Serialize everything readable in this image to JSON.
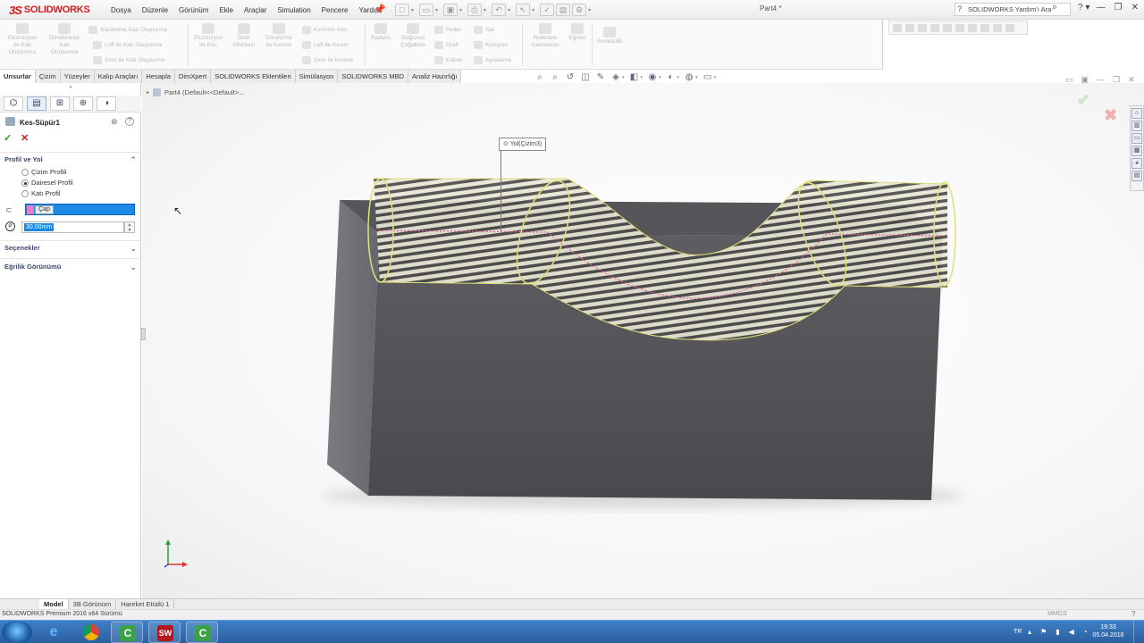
{
  "app": {
    "logo_text": "SOLIDWORKS",
    "logo_mark": "3S",
    "document_title": "Part4 *"
  },
  "menu": [
    "Dosya",
    "Düzenle",
    "Görünüm",
    "Ekle",
    "Araçlar",
    "Simulation",
    "Pencere",
    "Yardım"
  ],
  "help_search": {
    "placeholder": "SOLIDWORKS Yardım'ı Ara"
  },
  "window_controls": {
    "minimize": "—",
    "restore": "❐",
    "close": "✕"
  },
  "command_manager": {
    "extrude_boss": "Ekstrüzyon\nile Katı\nOluşturma",
    "revolve_boss": "Döndürerek\nKatı\nOluşturma",
    "sweep_boss": "Süpürerek Katı Oluşturma",
    "loft_boss": "Loft ile Katı Oluşturma",
    "boundary_boss": "Sınır ile Katı Oluşturma",
    "extrude_cut": "Ekstrüzyon\nile Kes",
    "hole_wizard": "Delik\nSihirbazı",
    "revolve_cut": "Döndürme\nile Kesme",
    "swept_cut": "Kırınımlı Kes",
    "lofted_cut": "Loft ile Kesim",
    "boundary_cut": "Sınır ile Kesme",
    "fillet": "Radyüs",
    "linear_pattern": "Doğrusal\nÇoğaltma",
    "rib": "Feder",
    "draft": "Draft",
    "shell": "Kabuk",
    "wrap": "Sar",
    "intersect": "Kesişme",
    "mirror": "Aynalama",
    "reference_geometry": "Referans\nGeometrisi",
    "curves": "Eğriler",
    "instant3d": "Anında3B"
  },
  "tabs": [
    "Unsurlar",
    "Çizim",
    "Yüzeyler",
    "Kalıp Araçları",
    "Hesapla",
    "DimXpert",
    "SOLIDWORKS Eklentileri",
    "Simülasyon",
    "SOLIDWORKS MBD",
    "Analiz Hazırlığı"
  ],
  "active_tab": "Unsurlar",
  "feature_manager": {
    "breadcrumb": "Part4  (Default<<Default>..."
  },
  "property_manager": {
    "title": "Kes-Süpür1",
    "groups": {
      "profile_path": "Profil ve Yol",
      "options": "Seçenekler",
      "curvature": "Eğrilik Görünümü"
    },
    "profile_options": [
      "Çizim Profili",
      "Dairesel Profil",
      "Katı Profil"
    ],
    "selected_profile": "Dairesel Profil",
    "path_selection_tag": "Çap",
    "diameter_value": "30.00mm"
  },
  "graphics": {
    "path_callout": "Yol(Çizim3)"
  },
  "bottom_tabs": [
    "Model",
    "3B Görünüm",
    "Hareket Etüdü 1"
  ],
  "active_bottom_tab": "Model",
  "status": {
    "text": "SOLIDWORKS Premium 2016 x64 Sürümü",
    "units": "MMGS",
    "help": "?"
  },
  "taskbar": {
    "apps": [
      "windows-explorer",
      "internet-explorer",
      "chrome",
      "camtasia",
      "solidworks",
      "camtasia-recorder"
    ],
    "language": "TR",
    "time": "19:33",
    "date": "05.04.2016",
    "solidworks_badge": "2016"
  },
  "colors": {
    "brand": "#d7191c",
    "selection": "#1e88e5",
    "taskbar": "#2a5f9e"
  }
}
